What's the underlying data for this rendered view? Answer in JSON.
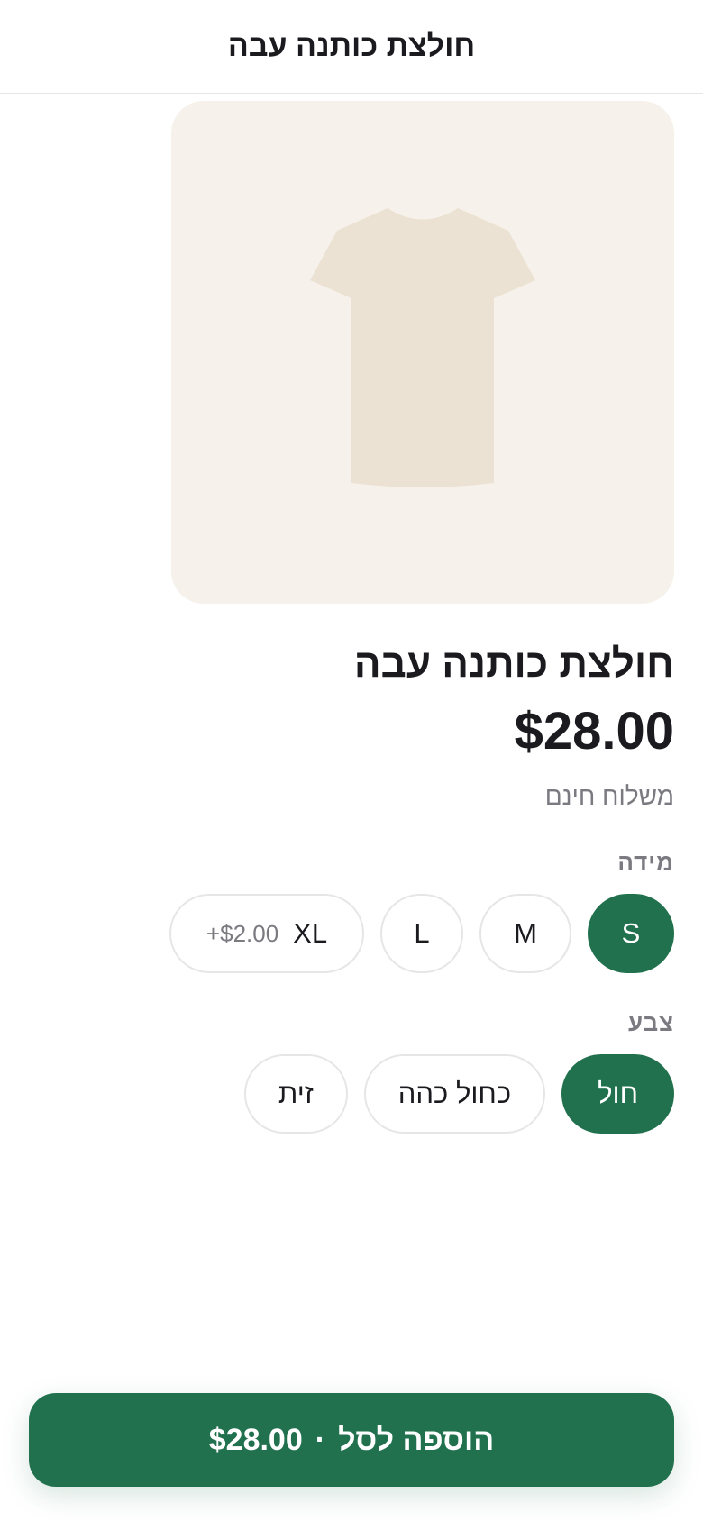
{
  "header": {
    "title": "חולצת כותנה עבה"
  },
  "product": {
    "name": "חולצת כותנה עבה",
    "price": "$28.00",
    "shipping": "משלוח חינם",
    "image_icon": "tshirt-icon",
    "colors": {
      "accent": "#21714e",
      "image_bg": "#f6f1ea",
      "shirt": "#ebe2d3"
    }
  },
  "size": {
    "label": "מידה",
    "options": [
      {
        "label": "S",
        "selected": true
      },
      {
        "label": "M",
        "selected": false
      },
      {
        "label": "L",
        "selected": false
      },
      {
        "label": "XL",
        "surcharge": "+$2.00",
        "selected": false
      }
    ]
  },
  "color": {
    "label": "צבע",
    "options": [
      {
        "label": "חול",
        "selected": true
      },
      {
        "label": "כחול כהה",
        "selected": false
      },
      {
        "label": "זית",
        "selected": false
      }
    ]
  },
  "cart_button": {
    "label": "הוספה לסל",
    "separator": "·",
    "amount": "$28.00"
  }
}
